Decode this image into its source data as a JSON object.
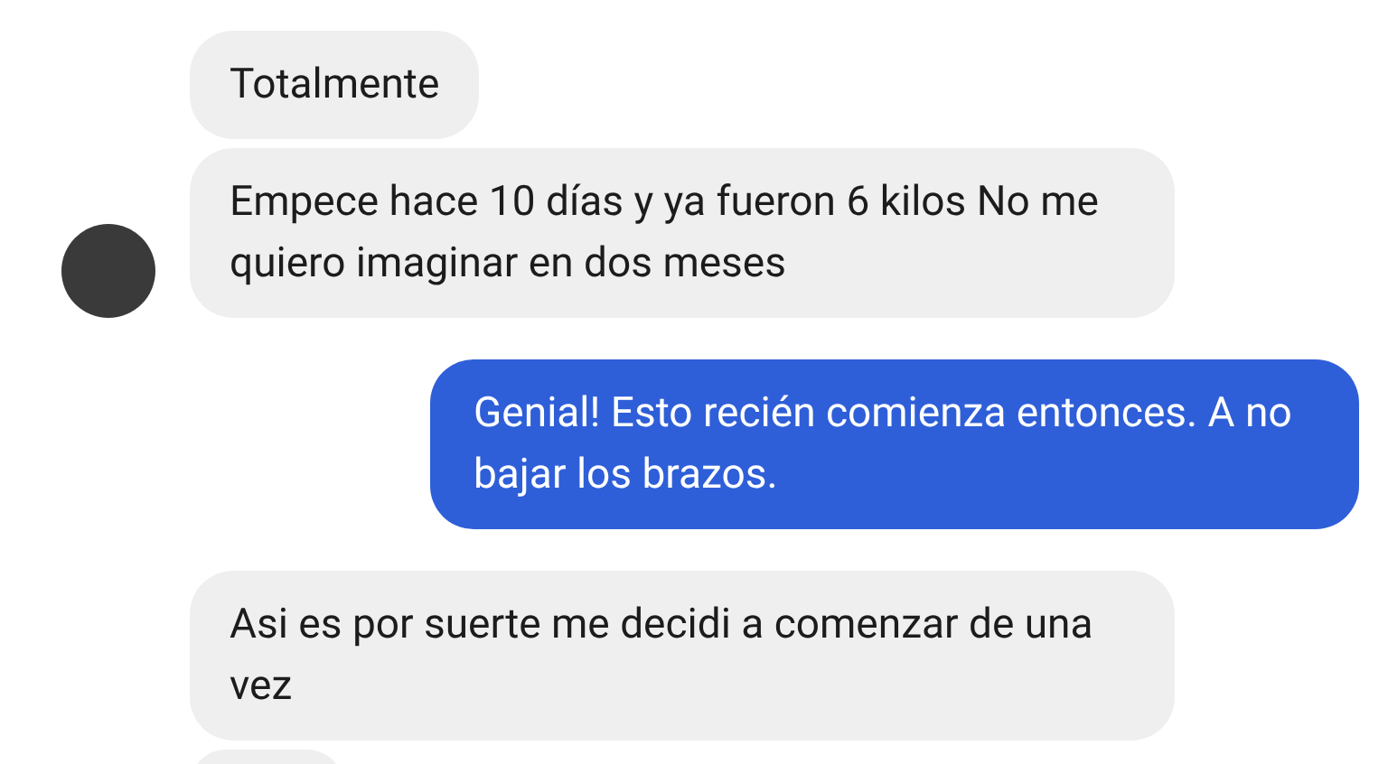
{
  "groups": [
    {
      "sent": false,
      "avatar": true,
      "messages": [
        "Totalmente",
        "Empece hace 10 días y ya fueron 6 kilos No me quiero imaginar en dos meses"
      ]
    },
    {
      "sent": true,
      "messages": [
        "Genial! Esto recién comienza entonces. A no bajar los brazos."
      ]
    },
    {
      "sent": false,
      "avatar": false,
      "messages": [
        "Asi es por suerte me decidi a comenzar de una vez"
      ],
      "more_below": true
    }
  ]
}
